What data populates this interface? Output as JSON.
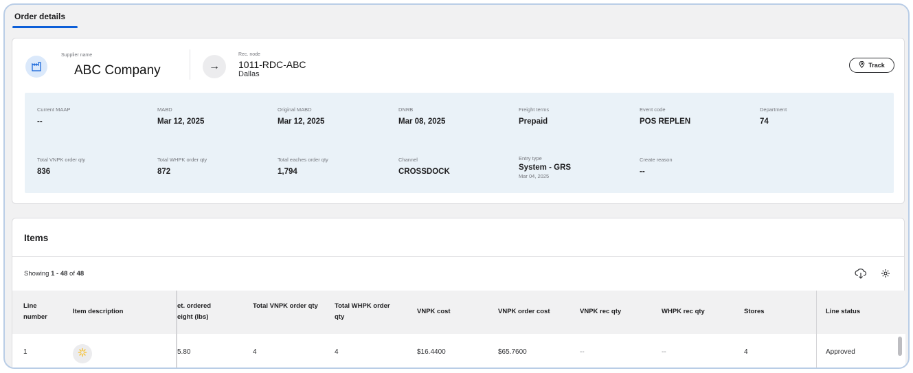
{
  "tabs": [
    {
      "label": "Order details"
    }
  ],
  "order": {
    "supplier_label": "Supplier name",
    "supplier_name": "ABC Company",
    "rec_node_label": "Rec. node",
    "rec_node": "1011-RDC-ABC",
    "rec_city": "Dallas",
    "track_label": "Track",
    "fields": [
      {
        "label": "Current MAAP",
        "value": "--"
      },
      {
        "label": "MABD",
        "value": "Mar 12, 2025"
      },
      {
        "label": "Original MABD",
        "value": "Mar 12, 2025"
      },
      {
        "label": "DNRB",
        "value": "Mar 08, 2025"
      },
      {
        "label": "Freight terms",
        "value": "Prepaid"
      },
      {
        "label": "Event code",
        "value": "POS REPLEN"
      },
      {
        "label": "Department",
        "value": "74"
      },
      {
        "label": "Total VNPK order qty",
        "value": "836"
      },
      {
        "label": "Total WHPK order qty",
        "value": "872"
      },
      {
        "label": "Total eaches order qty",
        "value": "1,794"
      },
      {
        "label": "Channel",
        "value": "CROSSDOCK"
      },
      {
        "label": "Entry type",
        "value": "System - GRS",
        "sub": "Mar 04, 2025"
      },
      {
        "label": "Create reason",
        "value": "--"
      }
    ]
  },
  "items": {
    "title": "Items",
    "showing_prefix": "Showing ",
    "showing_range": "1 - 48",
    "showing_of": " of ",
    "showing_total": "48",
    "columns": [
      "Line number",
      "Item description",
      "et. ordered eight (lbs)",
      "Total VNPK order qty",
      "Total WHPK order qty",
      "VNPK cost",
      "VNPK order cost",
      "VNPK rec qty",
      "WHPK rec qty",
      "Stores",
      "Line status"
    ],
    "rows": [
      {
        "line_number": "1",
        "weight": "5.80",
        "vnpk_qty": "4",
        "whpk_qty": "4",
        "vnpk_cost": "$16.4400",
        "vnpk_order_cost": "$65.7600",
        "vnpk_rec_qty": "--",
        "whpk_rec_qty": "--",
        "stores": "4",
        "status": "Approved"
      }
    ]
  },
  "colors": {
    "accent": "#0d5fd8",
    "panel": "#eaf2f8",
    "frame_border": "#b9cde6",
    "spark": "#f6c544"
  },
  "icons": [
    "supplier-icon",
    "arrow-right-icon",
    "location-pin-icon",
    "cloud-download-icon",
    "settings-gear-icon",
    "spark-icon"
  ]
}
